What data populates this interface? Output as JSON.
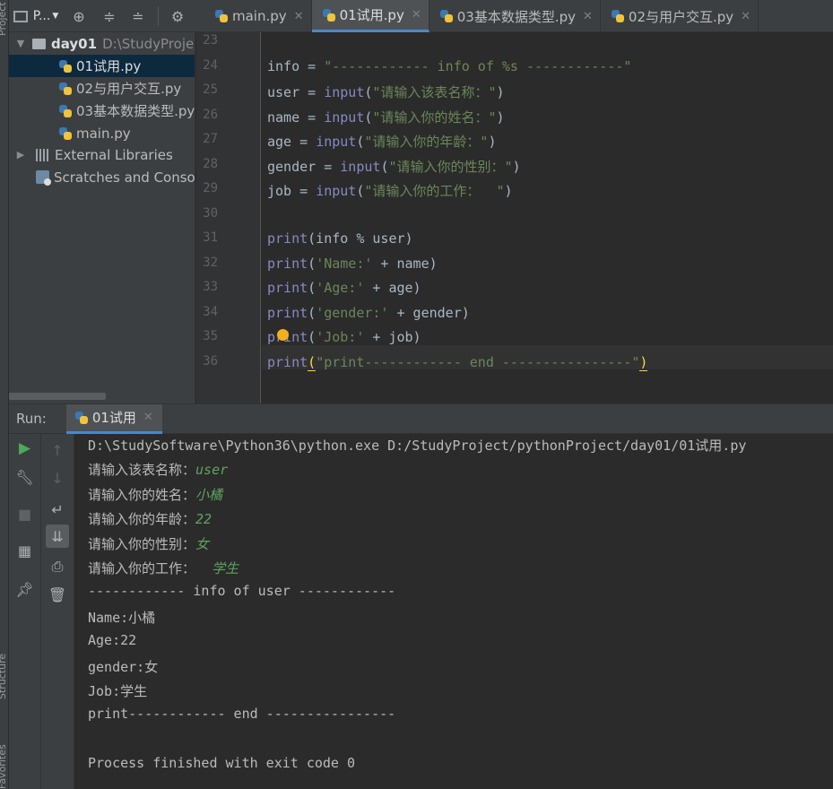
{
  "side_tabs": {
    "project": "Project",
    "structure": "Structure",
    "favorites": "Favorites"
  },
  "project_toolbar": {
    "view_label": "P..."
  },
  "tabs": [
    {
      "label": "main.py",
      "active": false
    },
    {
      "label": "01试用.py",
      "active": true
    },
    {
      "label": "03基本数据类型.py",
      "active": false
    },
    {
      "label": "02与用户交互.py",
      "active": false
    }
  ],
  "project_tree": {
    "root": {
      "name": "day01",
      "path": "D:\\StudyProje"
    },
    "files": [
      "01试用.py",
      "02与用户交互.py",
      "03基本数据类型.py",
      "main.py"
    ],
    "selected_file": "01试用.py",
    "external_libraries": "External Libraries",
    "scratches": "Scratches and Consol"
  },
  "editor": {
    "lines": [
      {
        "n": "23",
        "tokens": []
      },
      {
        "n": "24",
        "tokens": [
          [
            "",
            "info = "
          ],
          [
            "str",
            "\"------------ info of %s ------------\""
          ]
        ]
      },
      {
        "n": "25",
        "tokens": [
          [
            "",
            "user = "
          ],
          [
            "kw",
            "input"
          ],
          [
            "",
            "("
          ],
          [
            "str",
            "\"请输入该表名称：\""
          ],
          [
            "",
            ")"
          ]
        ]
      },
      {
        "n": "26",
        "tokens": [
          [
            "",
            "name = "
          ],
          [
            "kw",
            "input"
          ],
          [
            "",
            "("
          ],
          [
            "str",
            "\"请输入你的姓名：\""
          ],
          [
            "",
            ")"
          ]
        ]
      },
      {
        "n": "27",
        "tokens": [
          [
            "",
            "age = "
          ],
          [
            "kw",
            "input"
          ],
          [
            "",
            "("
          ],
          [
            "str",
            "\"请输入你的年龄：\""
          ],
          [
            "",
            ")"
          ]
        ]
      },
      {
        "n": "28",
        "tokens": [
          [
            "",
            "gender = "
          ],
          [
            "kw",
            "input"
          ],
          [
            "",
            "("
          ],
          [
            "str",
            "\"请输入你的性别：\""
          ],
          [
            "",
            ")"
          ]
        ]
      },
      {
        "n": "29",
        "tokens": [
          [
            "",
            "job = "
          ],
          [
            "kw",
            "input"
          ],
          [
            "",
            "("
          ],
          [
            "str",
            "\"请输入你的工作：  \""
          ],
          [
            "",
            ")"
          ]
        ]
      },
      {
        "n": "30",
        "tokens": []
      },
      {
        "n": "31",
        "tokens": [
          [
            "kw",
            "print"
          ],
          [
            "",
            "(info % user)"
          ]
        ]
      },
      {
        "n": "32",
        "tokens": [
          [
            "kw",
            "print"
          ],
          [
            "",
            "("
          ],
          [
            "str",
            "'Name:'"
          ],
          [
            "",
            " + name)"
          ]
        ]
      },
      {
        "n": "33",
        "tokens": [
          [
            "kw",
            "print"
          ],
          [
            "",
            "("
          ],
          [
            "str",
            "'Age:'"
          ],
          [
            "",
            " + age)"
          ]
        ]
      },
      {
        "n": "34",
        "tokens": [
          [
            "kw",
            "print"
          ],
          [
            "",
            "("
          ],
          [
            "str",
            "'gender:'"
          ],
          [
            "",
            " + gender)"
          ]
        ]
      },
      {
        "n": "35",
        "tokens": [
          [
            "kw",
            "print"
          ],
          [
            "",
            "("
          ],
          [
            "str",
            "'Job:'"
          ],
          [
            "",
            " + job)"
          ]
        ]
      },
      {
        "n": "36",
        "tokens": [
          [
            "kw",
            "print"
          ],
          [
            "hl",
            "("
          ],
          [
            "str",
            "\"print------------ end ----------------\""
          ],
          [
            "hl",
            ")"
          ]
        ]
      }
    ],
    "caret_line": "36"
  },
  "run": {
    "title": "Run:",
    "tab_label": "01试用",
    "console": [
      [
        [
          "",
          "D:\\StudySoftware\\Python36\\python.exe D:/StudyProject/pythonProject/day01/01试用.py"
        ]
      ],
      [
        [
          "",
          "请输入该表名称："
        ],
        [
          "inp",
          "user"
        ]
      ],
      [
        [
          "",
          "请输入你的姓名："
        ],
        [
          "inp",
          "小橘"
        ]
      ],
      [
        [
          "",
          "请输入你的年龄："
        ],
        [
          "inp",
          "22"
        ]
      ],
      [
        [
          "",
          "请输入你的性别："
        ],
        [
          "inp",
          "女"
        ]
      ],
      [
        [
          "",
          "请输入你的工作：  "
        ],
        [
          "inp",
          "学生"
        ]
      ],
      [
        [
          "",
          "------------ info of user ------------"
        ]
      ],
      [
        [
          "",
          "Name:小橘"
        ]
      ],
      [
        [
          "",
          "Age:22"
        ]
      ],
      [
        [
          "",
          "gender:女"
        ]
      ],
      [
        [
          "",
          "Job:学生"
        ]
      ],
      [
        [
          "",
          "print------------ end ----------------"
        ]
      ],
      [
        [
          "",
          ""
        ]
      ],
      [
        [
          "",
          "Process finished with exit code 0"
        ]
      ]
    ]
  },
  "colors": {
    "string": "#6a8759",
    "keyword": "#8888c6",
    "user_input": "#5fa35f",
    "accent": "#4a88c7"
  }
}
